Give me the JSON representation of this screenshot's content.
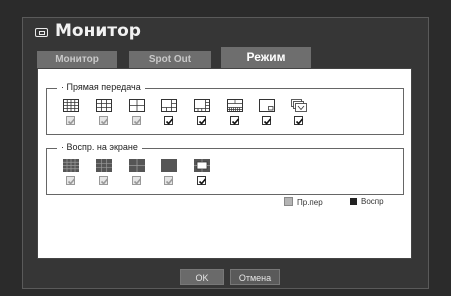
{
  "window": {
    "title": "Монитор",
    "icon": "monitor-icon"
  },
  "tabs": [
    {
      "label": "Монитор",
      "active": false
    },
    {
      "label": "Spot Out",
      "active": false
    },
    {
      "label": "Режим",
      "active": true
    }
  ],
  "live_group": {
    "label": "· Прямая передача",
    "items": [
      {
        "icon": "layout-16-icon",
        "checked": false
      },
      {
        "icon": "layout-9-icon",
        "checked": false
      },
      {
        "icon": "layout-4-icon",
        "checked": false
      },
      {
        "icon": "layout-6-icon",
        "checked": true
      },
      {
        "icon": "layout-8-icon",
        "checked": true
      },
      {
        "icon": "layout-13-icon",
        "checked": true
      },
      {
        "icon": "layout-pip-icon",
        "checked": true
      },
      {
        "icon": "layout-sequence-icon",
        "checked": true
      }
    ]
  },
  "playback_group": {
    "label": "· Воспр. на экране",
    "items": [
      {
        "icon": "layout-16-icon",
        "checked": false
      },
      {
        "icon": "layout-9-icon",
        "checked": false
      },
      {
        "icon": "layout-4-icon",
        "checked": false
      },
      {
        "icon": "layout-1-icon",
        "checked": false
      },
      {
        "icon": "layout-zoom-icon",
        "checked": true
      }
    ]
  },
  "status_legend": {
    "live_label": "Пр.пер",
    "playback_label": "Воспр",
    "live_color": "#b4b4b4",
    "playback_color": "#222222"
  },
  "buttons": {
    "ok": "OK",
    "cancel": "Отмена"
  }
}
